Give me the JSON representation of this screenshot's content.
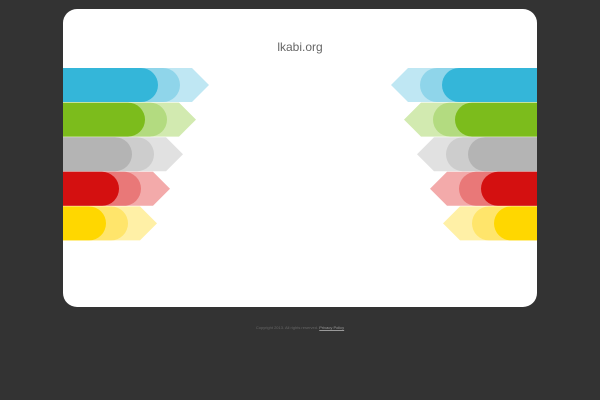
{
  "site": {
    "domain": "lkabi.org"
  },
  "footer": {
    "copyright": "Copyright 2013. All rights reserved.",
    "privacy_label": "Privacy Policy"
  },
  "theme": {
    "background": "#333333",
    "card": "#ffffff"
  },
  "bars": [
    {
      "name": "blue",
      "dark": "#34b6d9",
      "mid": "#8fd5ea",
      "light": "#bfe7f3"
    },
    {
      "name": "green",
      "dark": "#7cbc1c",
      "mid": "#b3db80",
      "light": "#d2eab0"
    },
    {
      "name": "gray",
      "dark": "#b4b4b4",
      "mid": "#cdcdcd",
      "light": "#e1e1e1"
    },
    {
      "name": "red",
      "dark": "#d41010",
      "mid": "#e97878",
      "light": "#f3aaaa"
    },
    {
      "name": "yellow",
      "dark": "#ffd700",
      "mid": "#ffe56b",
      "light": "#fff0a6"
    }
  ]
}
